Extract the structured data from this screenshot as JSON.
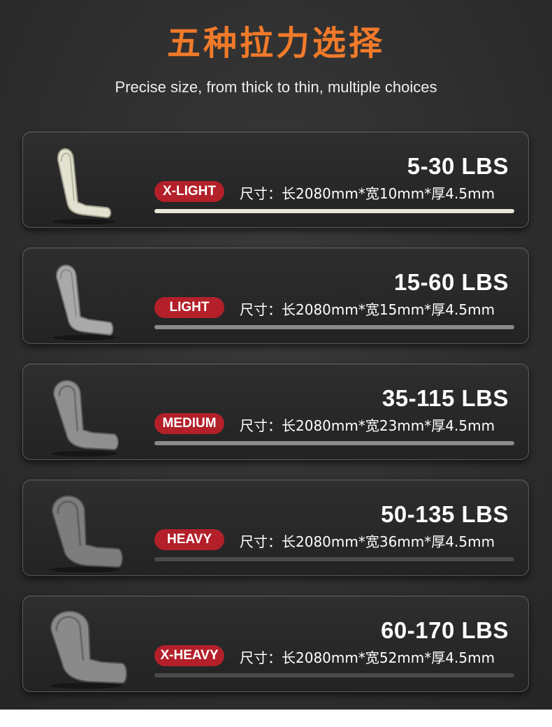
{
  "header": {
    "title": "五种拉力选择",
    "subtitle": "Precise size, from thick to thin, multiple choices"
  },
  "colors": {
    "title": "#f07a2a",
    "tag": "#b3202a"
  },
  "bands": [
    {
      "range": "5-30 LBS",
      "level": "X-LIGHT",
      "spec": "尺寸：长2080mm*宽10mm*厚4.5mm",
      "band_color": "#e3e1cf"
    },
    {
      "range": "15-60 LBS",
      "level": "LIGHT",
      "spec": "尺寸：长2080mm*宽15mm*厚4.5mm",
      "band_color": "#a9a9a9"
    },
    {
      "range": "35-115 LBS",
      "level": "MEDIUM",
      "spec": "尺寸：长2080mm*宽23mm*厚4.5mm",
      "band_color": "#8f8f8f"
    },
    {
      "range": "50-135 LBS",
      "level": "HEAVY",
      "spec": "尺寸：长2080mm*宽36mm*厚4.5mm",
      "band_color": "#7d7d7d"
    },
    {
      "range": "60-170 LBS",
      "level": "X-HEAVY",
      "spec": "尺寸：长2080mm*宽52mm*厚4.5mm",
      "band_color": "#8a8a8a"
    }
  ]
}
